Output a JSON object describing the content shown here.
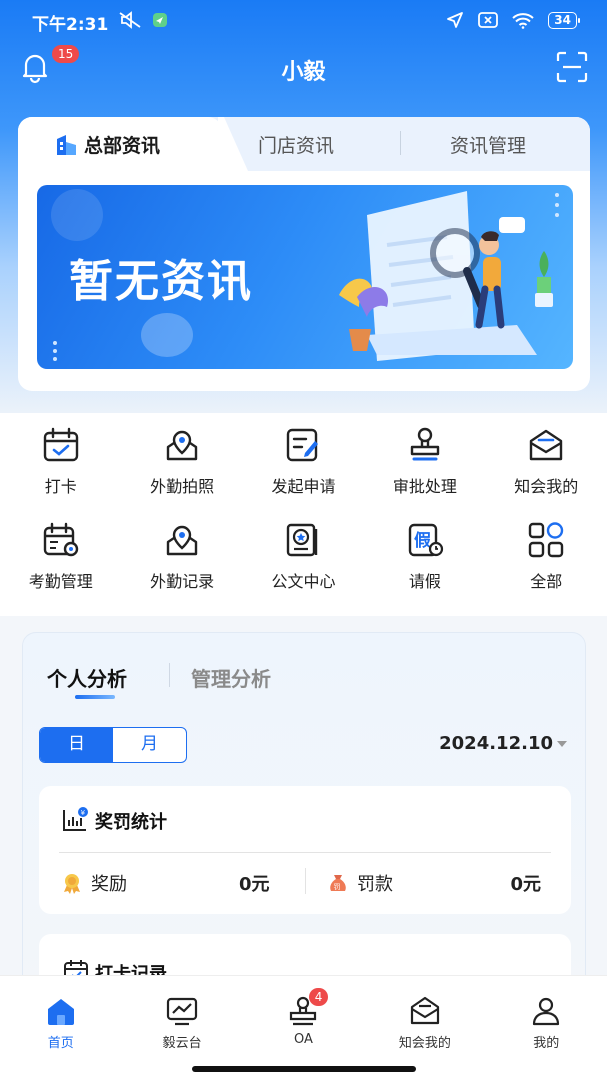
{
  "status_bar": {
    "time": "下午2:31",
    "battery": "34"
  },
  "header": {
    "title": "小毅",
    "notification_count": "15"
  },
  "news": {
    "tabs": [
      {
        "label": "总部资讯"
      },
      {
        "label": "门店资讯"
      },
      {
        "label": "资讯管理"
      }
    ],
    "banner_text": "暂无资讯"
  },
  "quick_actions": [
    {
      "label": "打卡",
      "icon": "calendar-check-icon"
    },
    {
      "label": "外勤拍照",
      "icon": "location-photo-icon"
    },
    {
      "label": "发起申请",
      "icon": "edit-form-icon"
    },
    {
      "label": "审批处理",
      "icon": "stamp-icon"
    },
    {
      "label": "知会我的",
      "icon": "mail-open-icon"
    },
    {
      "label": "考勤管理",
      "icon": "calendar-gear-icon"
    },
    {
      "label": "外勤记录",
      "icon": "location-record-icon"
    },
    {
      "label": "公文中心",
      "icon": "document-star-icon"
    },
    {
      "label": "请假",
      "icon": "leave-icon"
    },
    {
      "label": "全部",
      "icon": "grid-all-icon"
    }
  ],
  "analysis": {
    "tabs": [
      {
        "label": "个人分析"
      },
      {
        "label": "管理分析"
      }
    ],
    "period": {
      "day": "日",
      "month": "月",
      "selected": "日"
    },
    "date": "2024.12.10",
    "stats": {
      "title": "奖罚统计",
      "reward_label": "奖励",
      "reward_value": "0元",
      "fine_label": "罚款",
      "fine_value": "0元"
    },
    "punch": {
      "title": "打卡记录"
    }
  },
  "tabbar": {
    "items": [
      {
        "label": "首页",
        "icon": "home-icon",
        "active": true
      },
      {
        "label": "毅云台",
        "icon": "chart-monitor-icon"
      },
      {
        "label": "OA",
        "icon": "stamp-icon",
        "badge": "4"
      },
      {
        "label": "知会我的",
        "icon": "mail-open-icon"
      },
      {
        "label": "我的",
        "icon": "user-icon"
      }
    ]
  },
  "colors": {
    "primary": "#1d6ef0",
    "badge": "#ee4a4a"
  }
}
